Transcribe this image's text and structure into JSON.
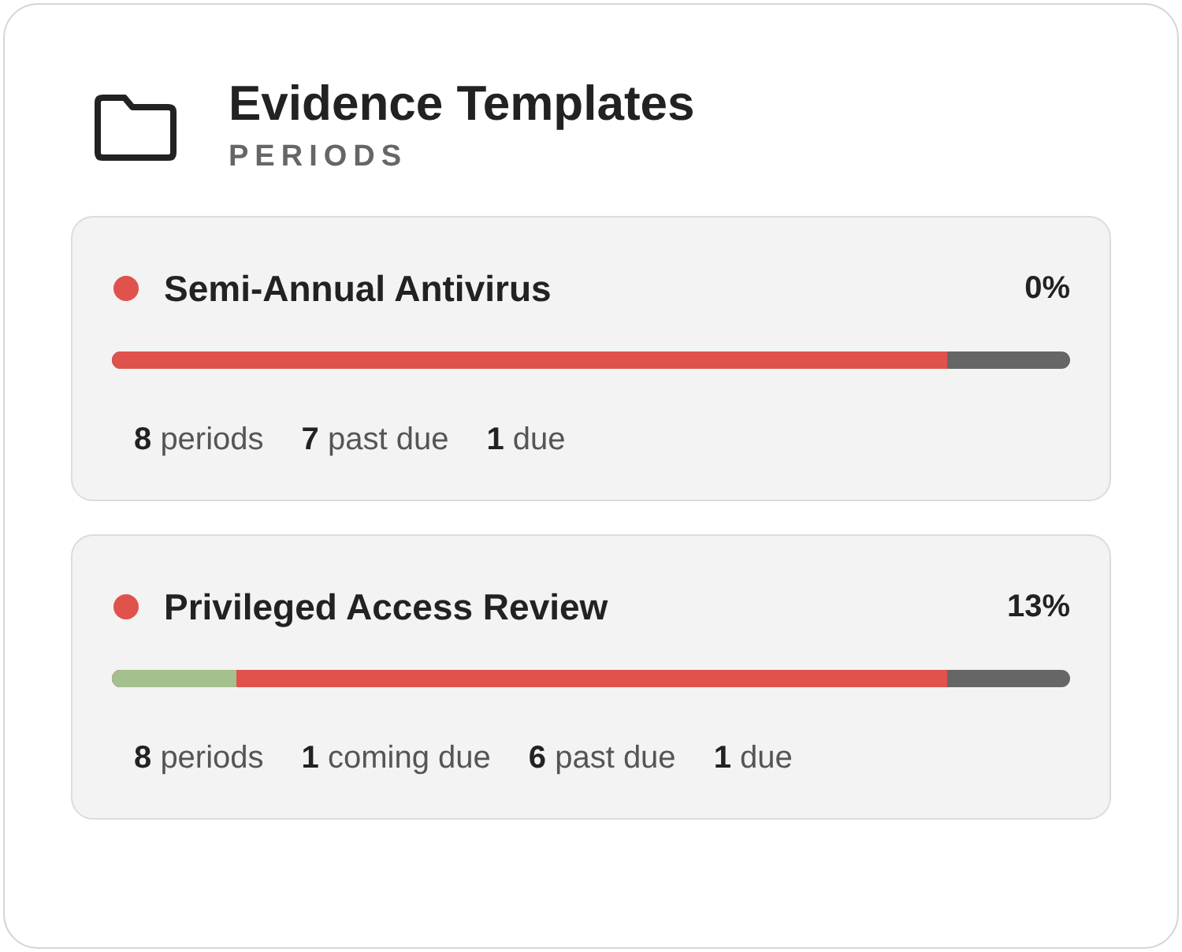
{
  "header": {
    "title": "Evidence Templates",
    "subtitle": "PERIODS"
  },
  "templates": [
    {
      "name": "Semi-Annual Antivirus",
      "color": "#e0524c",
      "percent": "0%",
      "segments": [
        {
          "level": 0.872,
          "color": "#e0524c"
        }
      ],
      "stats": [
        {
          "count": "8",
          "label": "periods"
        },
        {
          "count": "7",
          "label": "past due"
        },
        {
          "count": "1",
          "label": "due"
        }
      ]
    },
    {
      "name": "Privileged Access Review",
      "color": "#e0524c",
      "percent": "13%",
      "segments": [
        {
          "level": 0.872,
          "color": "#e0524c"
        },
        {
          "level": 0.13,
          "color": "#a3c08e"
        }
      ],
      "stats": [
        {
          "count": "8",
          "label": "periods"
        },
        {
          "count": "1",
          "label": "coming due"
        },
        {
          "count": "6",
          "label": "past due"
        },
        {
          "count": "1",
          "label": "due"
        }
      ]
    }
  ]
}
